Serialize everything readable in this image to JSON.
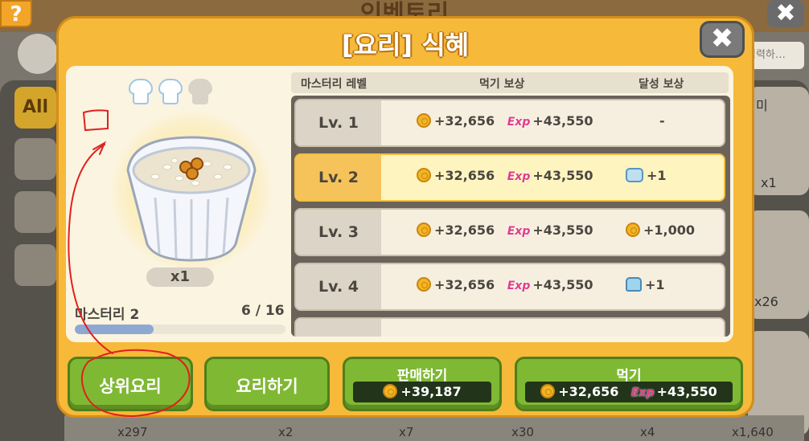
{
  "background": {
    "title": "인벤토리",
    "help_label": "?",
    "close_label": "✖",
    "search_placeholder": "입력하…",
    "tab_all_label": "All",
    "right_labels": [
      "미",
      "x1",
      "x26"
    ],
    "bottom_counts": [
      "x297",
      "x2",
      "x7",
      "x30",
      "x4",
      "x1,640"
    ]
  },
  "modal": {
    "title": "[요리] 식혜",
    "close_label": "✖",
    "dish": {
      "hats_earned": 2,
      "hats_total": 3,
      "quantity": "x1",
      "mastery_label": "마스터리 2",
      "mastery_count": "6 / 16",
      "mastery_progress": 0.375
    },
    "table": {
      "headers": {
        "level": "마스터리 레벨",
        "eat_reward": "먹기 보상",
        "achieve_reward": "달성 보상"
      },
      "exp_label": "Exp",
      "rows": [
        {
          "level": "Lv. 1",
          "coin": "+32,656",
          "exp": "+43,550",
          "reward_icon": "none",
          "reward": "-",
          "active": false
        },
        {
          "level": "Lv. 2",
          "coin": "+32,656",
          "exp": "+43,550",
          "reward_icon": "ticket-icon",
          "reward": "+1",
          "active": true
        },
        {
          "level": "Lv. 3",
          "coin": "+32,656",
          "exp": "+43,550",
          "reward_icon": "coin-icon",
          "reward": "+1,000",
          "active": false
        },
        {
          "level": "Lv. 4",
          "coin": "+32,656",
          "exp": "+43,550",
          "reward_icon": "shirt-icon",
          "reward": "+1",
          "active": false
        }
      ]
    },
    "buttons": {
      "upper_recipe": "상위요리",
      "cook": "요리하기",
      "sell": "판매하기",
      "sell_price": "+39,187",
      "eat": "먹기",
      "eat_coin": "+32,656",
      "eat_exp": "+43,550"
    }
  },
  "colors": {
    "modal_orange": "#f6b93a",
    "button_green": "#7fb833",
    "annotation_red": "#e02020"
  }
}
